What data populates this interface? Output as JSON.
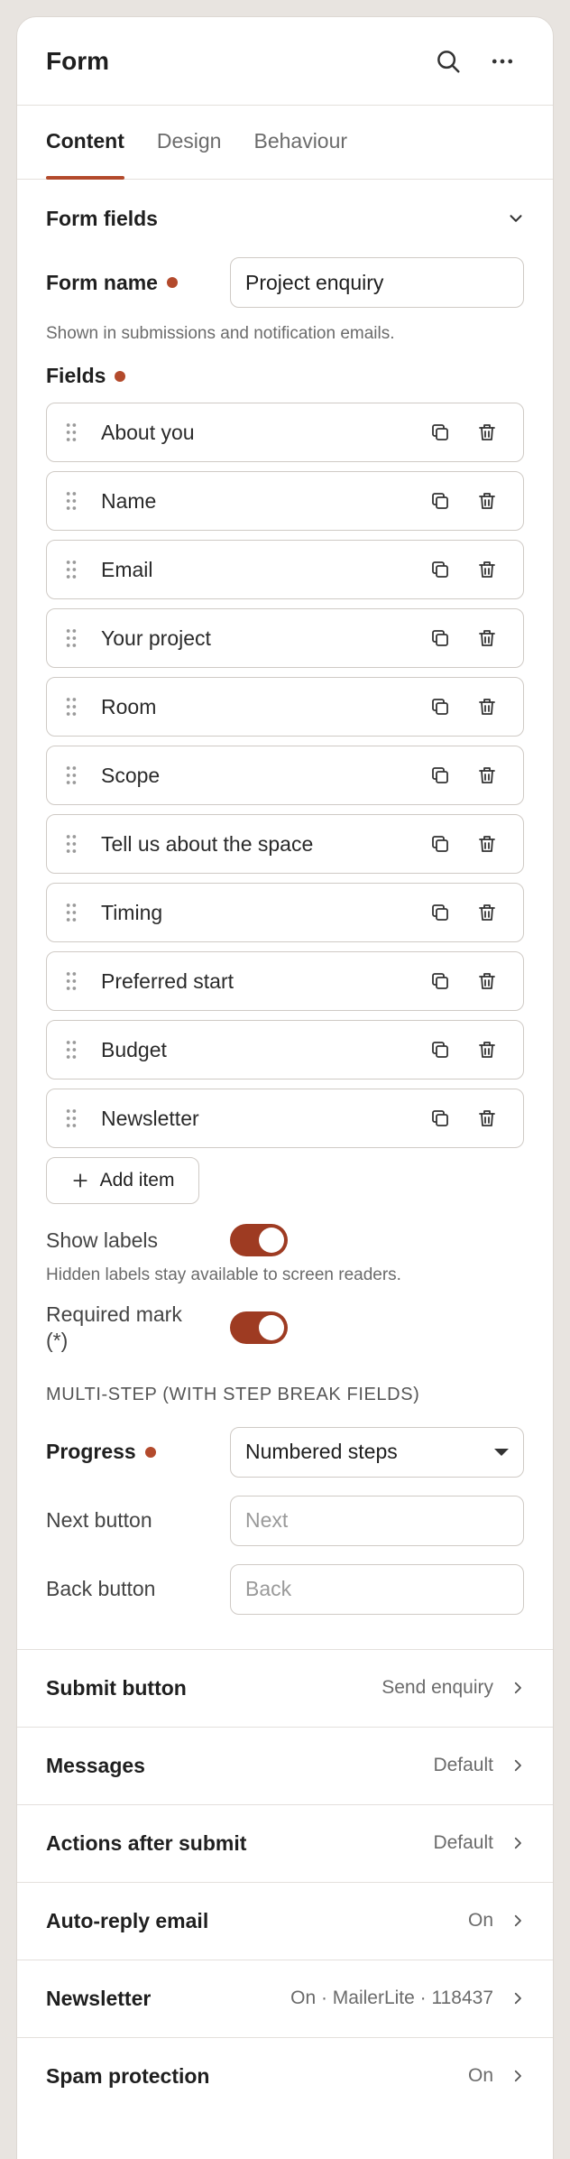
{
  "header": {
    "title": "Form"
  },
  "tabs": [
    {
      "label": "Content"
    },
    {
      "label": "Design"
    },
    {
      "label": "Behaviour"
    }
  ],
  "form_fields": {
    "title": "Form fields",
    "form_name_label": "Form name",
    "form_name_value": "Project enquiry",
    "form_name_hint": "Shown in submissions and notification emails.",
    "fields_label": "Fields",
    "items": [
      "About you",
      "Name",
      "Email",
      "Your project",
      "Room",
      "Scope",
      "Tell us about the space",
      "Timing",
      "Preferred start",
      "Budget",
      "Newsletter"
    ],
    "add_item_label": "Add item",
    "show_labels_label": "Show labels",
    "show_labels_hint": "Hidden labels stay available to screen readers.",
    "required_mark_label": "Required mark (*)",
    "multistep_heading": "Multi-step (with step break fields)",
    "progress_label": "Progress",
    "progress_value": "Numbered steps",
    "next_button_label": "Next button",
    "next_button_placeholder": "Next",
    "back_button_label": "Back button",
    "back_button_placeholder": "Back"
  },
  "sections": [
    {
      "title": "Submit button",
      "value": "Send enquiry"
    },
    {
      "title": "Messages",
      "value": "Default"
    },
    {
      "title": "Actions after submit",
      "value": "Default"
    },
    {
      "title": "Auto-reply email",
      "value": "On"
    },
    {
      "title": "Newsletter",
      "value": "On · MailerLite · 118437"
    },
    {
      "title": "Spam protection",
      "value": "On"
    }
  ],
  "colors": {
    "accent": "#b34a2c",
    "toggle_on": "#9e3b22"
  }
}
